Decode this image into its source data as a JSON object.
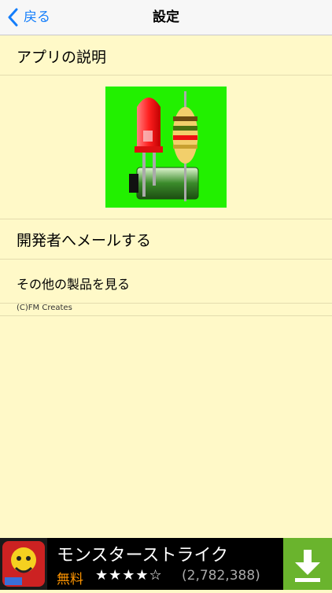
{
  "nav": {
    "back_label": "戻る",
    "title": "設定"
  },
  "menu": {
    "app_description": "アプリの説明",
    "mail_developer": "開発者へメールする",
    "other_products": "その他の製品を見る",
    "copyright": "(C)FM Creates"
  },
  "icon": {
    "name": "led-resistor-battery-app-icon",
    "background": "#22f000"
  },
  "ad": {
    "title": "モンスターストライク",
    "price": "無料",
    "stars": "★★★★☆",
    "rating_count": "(2,782,388)",
    "download_color": "#6ab42d"
  }
}
